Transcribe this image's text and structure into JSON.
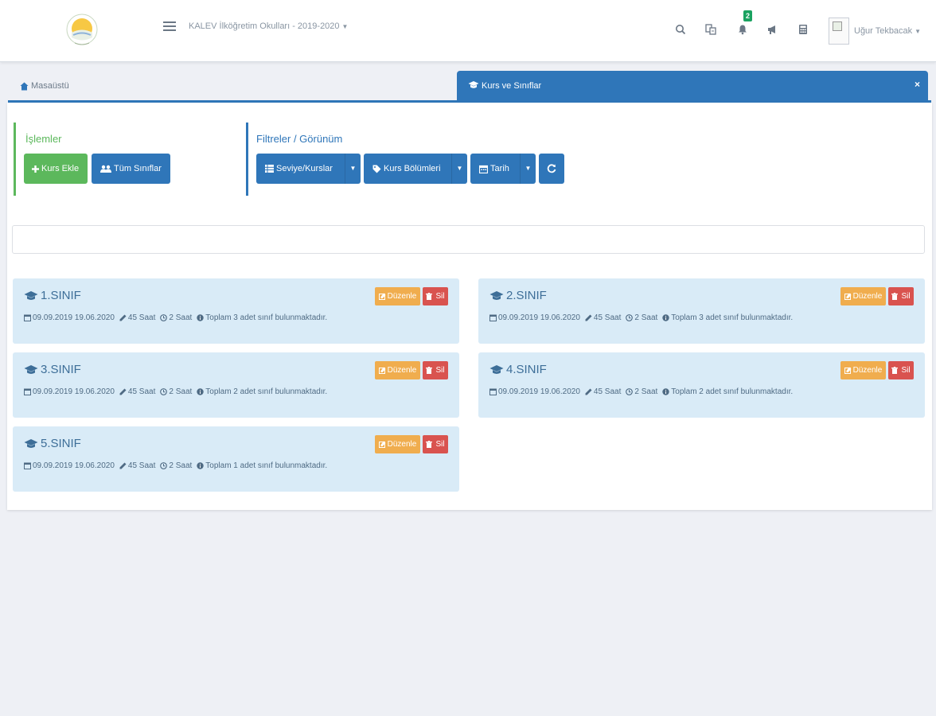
{
  "header": {
    "school": "KALEV İlköğretim Okulları - 2019-2020",
    "notification_count": "2",
    "username": "Uğur Tekbacak"
  },
  "icons": {
    "logo": "sun-logo-icon",
    "menu": "hamburger-menu-icon",
    "search": "search-icon",
    "translate": "translate-icon",
    "notifications": "bell-icon",
    "announcements": "megaphone-icon",
    "calculator": "calculator-icon"
  },
  "tabs": {
    "home": "Masaüstü",
    "active": "Kurs ve Sınıflar",
    "close": "×"
  },
  "operations": {
    "title": "İşlemler",
    "add_course": "Kurs Ekle",
    "all_classes": "Tüm Sınıflar"
  },
  "filters": {
    "title": "Filtreler / Görünüm",
    "level": "Seviye/Kurslar",
    "sections": "Kurs Bölümleri",
    "date": "Tarih"
  },
  "card_buttons": {
    "edit": "Düzenle",
    "delete": "Sil"
  },
  "classes": [
    {
      "name": "1.SINIF",
      "dates": "09.09.2019 19.06.2020",
      "hours": "45 Saat",
      "duration": "2 Saat",
      "total": "Toplam 3 adet sınıf bulunmaktadır."
    },
    {
      "name": "2.SINIF",
      "dates": "09.09.2019 19.06.2020",
      "hours": "45 Saat",
      "duration": "2 Saat",
      "total": "Toplam 3 adet sınıf bulunmaktadır."
    },
    {
      "name": "3.SINIF",
      "dates": "09.09.2019 19.06.2020",
      "hours": "45 Saat",
      "duration": "2 Saat",
      "total": "Toplam 2 adet sınıf bulunmaktadır."
    },
    {
      "name": "4.SINIF",
      "dates": "09.09.2019 19.06.2020",
      "hours": "45 Saat",
      "duration": "2 Saat",
      "total": "Toplam 2 adet sınıf bulunmaktadır."
    },
    {
      "name": "5.SINIF",
      "dates": "09.09.2019 19.06.2020",
      "hours": "45 Saat",
      "duration": "2 Saat",
      "total": "Toplam 1 adet sınıf bulunmaktadır."
    }
  ],
  "colors": {
    "primary": "#2f76b9",
    "success": "#5cb85c",
    "warning": "#f0ad4e",
    "danger": "#d9534f",
    "card_bg": "#d9ebf7"
  }
}
